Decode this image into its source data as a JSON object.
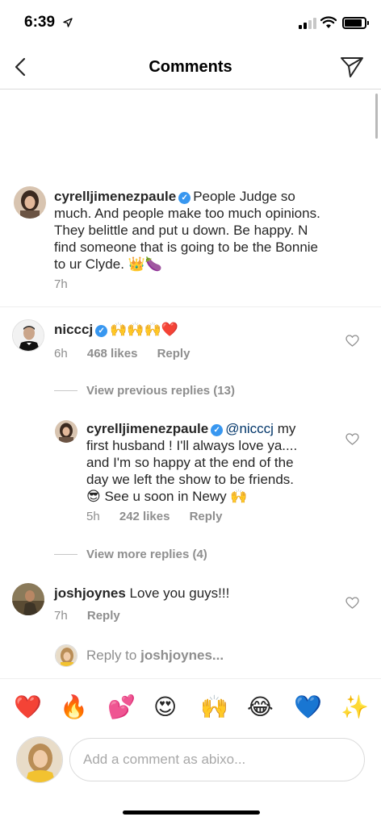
{
  "status_bar": {
    "time": "6:39"
  },
  "nav": {
    "title": "Comments"
  },
  "comments": [
    {
      "username": "cyrelljimenezpaule",
      "text": "People Judge so much. And people make too much opinions. They belittle and put u down. Be happy. N find someone that is going to be the Bonnie to ur Clyde.",
      "emojis": "👑🍆",
      "time": "7h"
    },
    {
      "username": "nicccj",
      "emojis": "🙌🙌🙌❤️",
      "time": "6h",
      "likes": "468 likes",
      "reply_label": "Reply"
    }
  ],
  "view_previous_replies": "View previous replies (13)",
  "reply": {
    "username": "cyrelljimenezpaule",
    "mention": "@nicccj",
    "text_line1": "my",
    "text_rest": "first husband ! I'll always love ya.... and I'm so happy at the end of the day we left the show to be friends.",
    "emoji_start": "😎",
    "text_end": "See u soon in Newy",
    "emoji_end": "🙌",
    "time": "5h",
    "likes": "242 likes",
    "reply_label": "Reply"
  },
  "view_more_replies": "View more replies (4)",
  "comment3": {
    "username": "joshjoynes",
    "text": "Love  you guys!!!",
    "time": "7h",
    "reply_label": "Reply"
  },
  "reply_to": {
    "prefix": "Reply to",
    "username": "joshjoynes..."
  },
  "emoji_bar": [
    {
      "icon": "red-heart-icon",
      "glyph": "❤️"
    },
    {
      "icon": "fire-icon",
      "glyph": "🔥"
    },
    {
      "icon": "two-hearts-icon",
      "glyph": "💕"
    },
    {
      "icon": "heart-eyes-icon",
      "glyph": "😍"
    },
    {
      "icon": "raised-hands-icon",
      "glyph": "🙌"
    },
    {
      "icon": "tears-of-joy-icon",
      "glyph": "😂"
    },
    {
      "icon": "blue-heart-icon",
      "glyph": "💙"
    },
    {
      "icon": "sparkles-icon",
      "glyph": "✨"
    }
  ],
  "compose": {
    "placeholder": "Add a comment as abixo..."
  },
  "colors": {
    "link_blue": "#3897f0",
    "muted": "#8e8e8e",
    "text": "#262626"
  }
}
